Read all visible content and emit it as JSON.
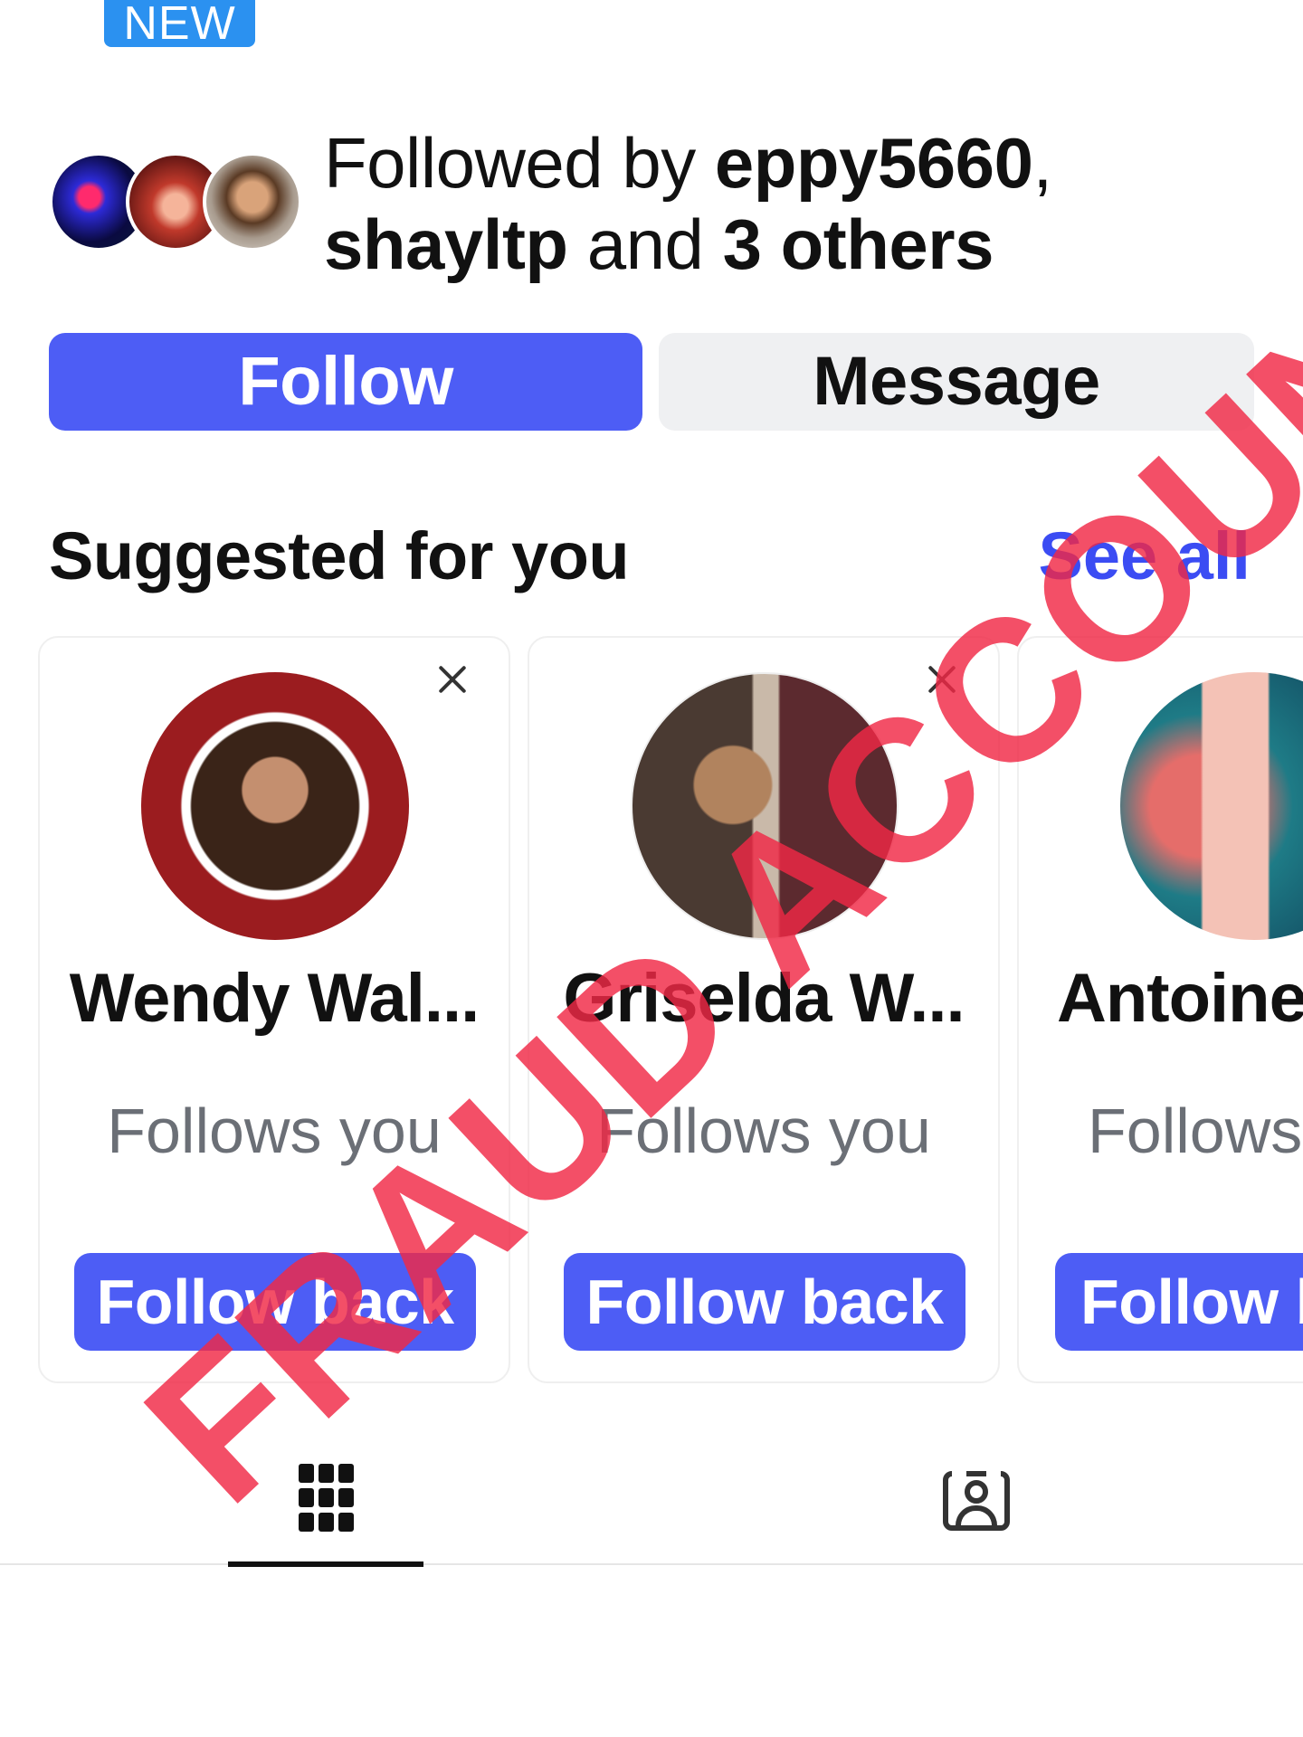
{
  "badge": {
    "label": "NEW"
  },
  "followers": {
    "prefix": "Followed by ",
    "user1": "eppy5660",
    "sep": ",",
    "user2": "shayltp",
    "middle": " and ",
    "others": "3 others"
  },
  "actions": {
    "follow_label": "Follow",
    "message_label": "Message"
  },
  "suggested": {
    "title": "Suggested for you",
    "see_all": "See all",
    "cards": [
      {
        "name": "Wendy Wal...",
        "subtitle": "Follows you",
        "button": "Follow back"
      },
      {
        "name": "Griselda W...",
        "subtitle": "Follows you",
        "button": "Follow back"
      },
      {
        "name": "Antoine",
        "subtitle": "Follows",
        "button": "Follow b"
      }
    ]
  },
  "tabs": [
    {
      "icon": "grid-icon",
      "active": true
    },
    {
      "icon": "tagged-person-icon",
      "active": false
    }
  ],
  "overlay": {
    "text": "FRAUD ACCOUNT",
    "color": "#f0284a"
  },
  "colors": {
    "primary_button": "#4d5df5",
    "secondary_button": "#eff0f2",
    "link": "#3b4cf3",
    "badge": "#2b91f0"
  }
}
